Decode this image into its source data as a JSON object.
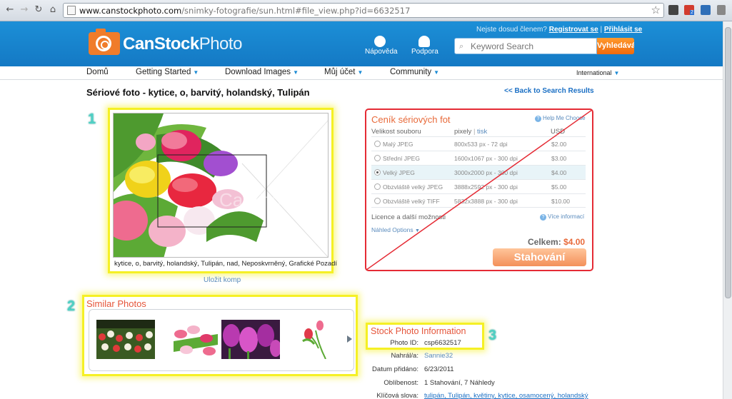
{
  "browser": {
    "url_domain": "www.canstockphoto.com",
    "url_path": "/snimky-fotografie/sun.html#file_view.php?id=6632517",
    "ext_badge": "2"
  },
  "header": {
    "logo_main": "CanStock",
    "logo_sub": "Photo",
    "help_label": "Nápověda",
    "support_label": "Podpora",
    "not_member": "Nejste dosud členem?",
    "register": "Registrovat se",
    "separator": "|",
    "login": "Přihlásit se",
    "search_placeholder": "Keyword Search",
    "search_button": "Vyhledávání!"
  },
  "nav": {
    "items": [
      "Domů",
      "Getting Started",
      "Download Images",
      "Můj účet",
      "Community"
    ],
    "region": "International"
  },
  "page": {
    "title": "Sériové foto - kytice, o, barvitý, holandský, Tulipán",
    "back_link": "<< Back to Search Results",
    "step1": "1",
    "step2": "2",
    "step3": "3",
    "watermark": "CanStock",
    "caption": "kytice, o, barvitý, holandský, Tulipán, nad, Neposkvrněný, Grafické Pozadí",
    "save_comp": "Uložit komp"
  },
  "pricing": {
    "title": "Ceník sériových fot",
    "help": "Help Me Choose",
    "col_size": "Velikost souboru",
    "col_pixels": "pixely",
    "col_sep": "|",
    "col_print": "tisk",
    "col_usd": "USD",
    "rows": [
      {
        "size": "Malý JPEG",
        "pixels": "800x533 px - 72 dpi",
        "price": "$2.00"
      },
      {
        "size": "Střední JPEG",
        "pixels": "1600x1067 px - 300 dpi",
        "price": "$3.00"
      },
      {
        "size": "Velký JPEG",
        "pixels": "3000x2000 px - 300 dpi",
        "price": "$4.00"
      },
      {
        "size": "Obzvláště velký JPEG",
        "pixels": "3888x2592 px - 300 dpi",
        "price": "$5.00"
      },
      {
        "size": "Obzvláště velký TIFF",
        "pixels": "5832x3888 px - 300 dpi",
        "price": "$10.00"
      }
    ],
    "selected_index": 2,
    "licence": "Licence a další možnosti",
    "more_info": "Více informací",
    "preview_options": "Náhled Options",
    "total_label": "Celkem:",
    "total_value": "$4.00",
    "download": "Stahování"
  },
  "similar": {
    "title": "Similar Photos"
  },
  "info": {
    "title": "Stock Photo Information",
    "photo_id_label": "Photo ID:",
    "photo_id": "csp6632517",
    "uploaded_label": "Nahrál/a:",
    "uploaded": "Sannie32",
    "date_label": "Datum přidáno:",
    "date": "6/23/2011",
    "popularity_label": "Oblíbenost:",
    "popularity": "1 Stahování, 7 Náhledy",
    "keywords_label": "Klíčová slova:",
    "keywords": "tulipán, Tulipán, květiny, kytice, osamocený, holandský"
  },
  "colors": {
    "header_blue": "#1a86d0",
    "accent_orange": "#f07c2a",
    "highlight_yellow": "#f5f025",
    "annotation_red": "#e52b35",
    "step_teal": "#4fd1c5"
  }
}
